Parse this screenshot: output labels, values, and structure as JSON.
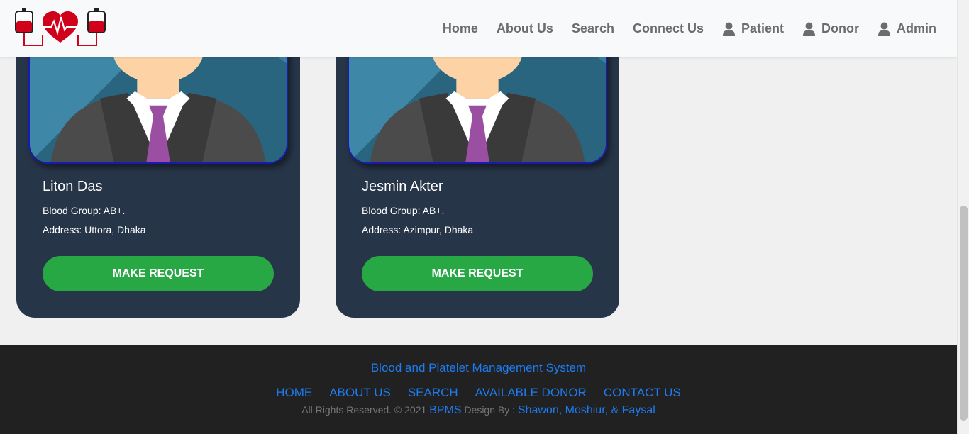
{
  "navbar": {
    "logo_icon": "blood-bag-heartbeat-logo",
    "items": [
      {
        "label": "Home",
        "icon": null
      },
      {
        "label": "About Us",
        "icon": null
      },
      {
        "label": "Search",
        "icon": null
      },
      {
        "label": "Connect Us",
        "icon": null
      },
      {
        "label": "Patient",
        "icon": "user-icon"
      },
      {
        "label": "Donor",
        "icon": "user-icon"
      },
      {
        "label": "Admin",
        "icon": "user-icon"
      }
    ]
  },
  "donors": [
    {
      "name": "Liton Das",
      "blood_group": "Blood Group: AB+.",
      "address": "Address: Uttora, Dhaka",
      "button": "MAKE REQUEST"
    },
    {
      "name": "Jesmin Akter",
      "blood_group": "Blood Group: AB+.",
      "address": "Address: Azimpur, Dhaka",
      "button": "MAKE REQUEST"
    }
  ],
  "footer": {
    "title": "Blood and Platelet Management System",
    "links": [
      "HOME",
      "ABOUT US",
      "SEARCH",
      "AVAILABLE DONOR",
      "CONTACT US"
    ],
    "copyright_prefix": "All Rights Reserved. © 2021",
    "brand": "BPMS",
    "design_by": "Design By :",
    "authors": "Shawon, Moshiur, & Faysal"
  },
  "colors": {
    "card_bg": "#273549",
    "button_green": "#28a745",
    "footer_bg": "#212121",
    "link_blue": "#1e7bf0",
    "brand_red": "#d0021b"
  }
}
